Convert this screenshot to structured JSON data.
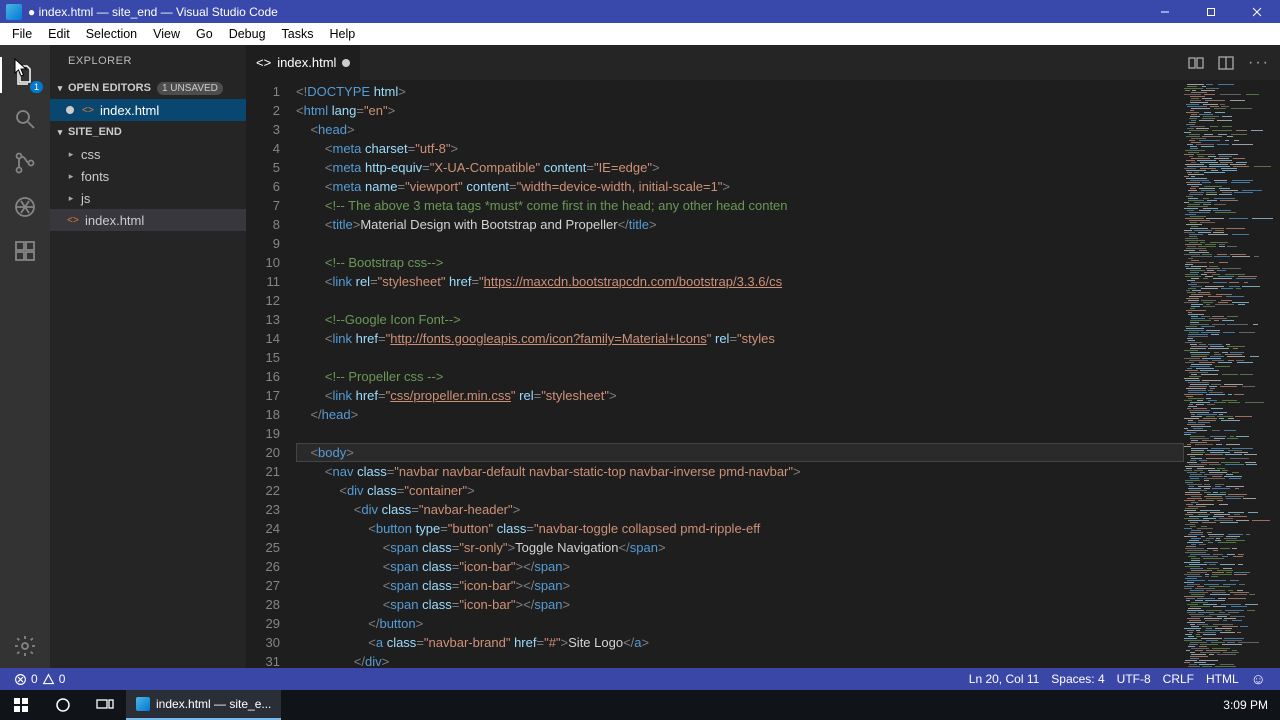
{
  "window": {
    "title": "● index.html — site_end — Visual Studio Code"
  },
  "menus": [
    "File",
    "Edit",
    "Selection",
    "View",
    "Go",
    "Debug",
    "Tasks",
    "Help"
  ],
  "activity": {
    "explorer_badge": "1"
  },
  "explorer": {
    "title": "EXPLORER",
    "open_editors": "OPEN EDITORS",
    "unsaved_tag": "1 UNSAVED",
    "open_file": "index.html",
    "project": "SITE_END",
    "folders": [
      "css",
      "fonts",
      "js"
    ],
    "file": "index.html"
  },
  "tab": {
    "name": "index.html"
  },
  "status": {
    "errors": "0",
    "warnings": "0",
    "ln_col": "Ln 20, Col 11",
    "spaces": "Spaces: 4",
    "encoding": "UTF-8",
    "eol": "CRLF",
    "lang": "HTML"
  },
  "taskbar": {
    "task_label": "index.html — site_e...",
    "clock": "3:09 PM"
  },
  "code": [
    {
      "n": 1,
      "i": 0,
      "tokens": [
        [
          "punc",
          "<!"
        ],
        [
          "doc",
          "DOCTYPE "
        ],
        [
          "attr",
          "html"
        ],
        [
          "punc",
          ">"
        ]
      ]
    },
    {
      "n": 2,
      "i": 0,
      "tokens": [
        [
          "punc",
          "<"
        ],
        [
          "tag",
          "html "
        ],
        [
          "attr",
          "lang"
        ],
        [
          "punc",
          "="
        ],
        [
          "str",
          "\"en\""
        ],
        [
          "punc",
          ">"
        ]
      ]
    },
    {
      "n": 3,
      "i": 1,
      "tokens": [
        [
          "punc",
          "<"
        ],
        [
          "tag",
          "head"
        ],
        [
          "punc",
          ">"
        ]
      ]
    },
    {
      "n": 4,
      "i": 2,
      "tokens": [
        [
          "punc",
          "<"
        ],
        [
          "tag",
          "meta "
        ],
        [
          "attr",
          "charset"
        ],
        [
          "punc",
          "="
        ],
        [
          "str",
          "\"utf-8\""
        ],
        [
          "punc",
          ">"
        ]
      ]
    },
    {
      "n": 5,
      "i": 2,
      "tokens": [
        [
          "punc",
          "<"
        ],
        [
          "tag",
          "meta "
        ],
        [
          "attr",
          "http-equiv"
        ],
        [
          "punc",
          "="
        ],
        [
          "str",
          "\"X-UA-Compatible\" "
        ],
        [
          "attr",
          "content"
        ],
        [
          "punc",
          "="
        ],
        [
          "str",
          "\"IE=edge\""
        ],
        [
          "punc",
          ">"
        ]
      ]
    },
    {
      "n": 6,
      "i": 2,
      "tokens": [
        [
          "punc",
          "<"
        ],
        [
          "tag",
          "meta "
        ],
        [
          "attr",
          "name"
        ],
        [
          "punc",
          "="
        ],
        [
          "str",
          "\"viewport\" "
        ],
        [
          "attr",
          "content"
        ],
        [
          "punc",
          "="
        ],
        [
          "str",
          "\"width=device-width, initial-scale=1\""
        ],
        [
          "punc",
          ">"
        ]
      ]
    },
    {
      "n": 7,
      "i": 2,
      "tokens": [
        [
          "cmt",
          "<!-- The above 3 meta tags *must* come first in the head; any other head conten"
        ]
      ]
    },
    {
      "n": 8,
      "i": 2,
      "tokens": [
        [
          "punc",
          "<"
        ],
        [
          "tag",
          "title"
        ],
        [
          "punc",
          ">"
        ],
        [
          "text",
          "Material Design with Bootstrap and Propeller"
        ],
        [
          "punc",
          "</"
        ],
        [
          "tag",
          "title"
        ],
        [
          "punc",
          ">"
        ]
      ]
    },
    {
      "n": 9,
      "i": 0,
      "tokens": []
    },
    {
      "n": 10,
      "i": 2,
      "tokens": [
        [
          "cmt",
          "<!-- Bootstrap css-->"
        ]
      ]
    },
    {
      "n": 11,
      "i": 2,
      "tokens": [
        [
          "punc",
          "<"
        ],
        [
          "tag",
          "link "
        ],
        [
          "attr",
          "rel"
        ],
        [
          "punc",
          "="
        ],
        [
          "str",
          "\"stylesheet\" "
        ],
        [
          "attr",
          "href"
        ],
        [
          "punc",
          "="
        ],
        [
          "str",
          "\""
        ],
        [
          "link",
          "https://maxcdn.bootstrapcdn.com/bootstrap/3.3.6/cs"
        ]
      ]
    },
    {
      "n": 12,
      "i": 0,
      "tokens": []
    },
    {
      "n": 13,
      "i": 2,
      "tokens": [
        [
          "cmt",
          "<!--Google Icon Font-->"
        ]
      ]
    },
    {
      "n": 14,
      "i": 2,
      "tokens": [
        [
          "punc",
          "<"
        ],
        [
          "tag",
          "link "
        ],
        [
          "attr",
          "href"
        ],
        [
          "punc",
          "="
        ],
        [
          "str",
          "\""
        ],
        [
          "link",
          "http://fonts.googleapis.com/icon?family=Material+Icons"
        ],
        [
          "str",
          "\" "
        ],
        [
          "attr",
          "rel"
        ],
        [
          "punc",
          "="
        ],
        [
          "str",
          "\"styles"
        ]
      ]
    },
    {
      "n": 15,
      "i": 0,
      "tokens": []
    },
    {
      "n": 16,
      "i": 2,
      "tokens": [
        [
          "cmt",
          "<!-- Propeller css -->"
        ]
      ]
    },
    {
      "n": 17,
      "i": 2,
      "tokens": [
        [
          "punc",
          "<"
        ],
        [
          "tag",
          "link "
        ],
        [
          "attr",
          "href"
        ],
        [
          "punc",
          "="
        ],
        [
          "str",
          "\""
        ],
        [
          "link",
          "css/propeller.min.css"
        ],
        [
          "str",
          "\" "
        ],
        [
          "attr",
          "rel"
        ],
        [
          "punc",
          "="
        ],
        [
          "str",
          "\"stylesheet\""
        ],
        [
          "punc",
          ">"
        ]
      ]
    },
    {
      "n": 18,
      "i": 1,
      "tokens": [
        [
          "punc",
          "</"
        ],
        [
          "tag",
          "head"
        ],
        [
          "punc",
          ">"
        ]
      ]
    },
    {
      "n": 19,
      "i": 0,
      "tokens": []
    },
    {
      "n": 20,
      "i": 1,
      "hl": true,
      "tokens": [
        [
          "punc",
          "<"
        ],
        [
          "tag",
          "body"
        ],
        [
          "punc",
          ">"
        ]
      ]
    },
    {
      "n": 21,
      "i": 2,
      "tokens": [
        [
          "punc",
          "<"
        ],
        [
          "tag",
          "nav "
        ],
        [
          "attr",
          "class"
        ],
        [
          "punc",
          "="
        ],
        [
          "str",
          "\"navbar navbar-default navbar-static-top navbar-inverse pmd-navbar\""
        ],
        [
          "punc",
          ">"
        ]
      ]
    },
    {
      "n": 22,
      "i": 3,
      "tokens": [
        [
          "punc",
          "<"
        ],
        [
          "tag",
          "div "
        ],
        [
          "attr",
          "class"
        ],
        [
          "punc",
          "="
        ],
        [
          "str",
          "\"container\""
        ],
        [
          "punc",
          ">"
        ]
      ]
    },
    {
      "n": 23,
      "i": 4,
      "tokens": [
        [
          "punc",
          "<"
        ],
        [
          "tag",
          "div "
        ],
        [
          "attr",
          "class"
        ],
        [
          "punc",
          "="
        ],
        [
          "str",
          "\"navbar-header\""
        ],
        [
          "punc",
          ">"
        ]
      ]
    },
    {
      "n": 24,
      "i": 5,
      "tokens": [
        [
          "punc",
          "<"
        ],
        [
          "tag",
          "button "
        ],
        [
          "attr",
          "type"
        ],
        [
          "punc",
          "="
        ],
        [
          "str",
          "\"button\" "
        ],
        [
          "attr",
          "class"
        ],
        [
          "punc",
          "="
        ],
        [
          "str",
          "\"navbar-toggle collapsed pmd-ripple-eff"
        ]
      ]
    },
    {
      "n": 25,
      "i": 6,
      "tokens": [
        [
          "punc",
          "<"
        ],
        [
          "tag",
          "span "
        ],
        [
          "attr",
          "class"
        ],
        [
          "punc",
          "="
        ],
        [
          "str",
          "\"sr-only\""
        ],
        [
          "punc",
          ">"
        ],
        [
          "text",
          "Toggle Navigation"
        ],
        [
          "punc",
          "</"
        ],
        [
          "tag",
          "span"
        ],
        [
          "punc",
          ">"
        ]
      ]
    },
    {
      "n": 26,
      "i": 6,
      "tokens": [
        [
          "punc",
          "<"
        ],
        [
          "tag",
          "span "
        ],
        [
          "attr",
          "class"
        ],
        [
          "punc",
          "="
        ],
        [
          "str",
          "\"icon-bar\""
        ],
        [
          "punc",
          "></"
        ],
        [
          "tag",
          "span"
        ],
        [
          "punc",
          ">"
        ]
      ]
    },
    {
      "n": 27,
      "i": 6,
      "tokens": [
        [
          "punc",
          "<"
        ],
        [
          "tag",
          "span "
        ],
        [
          "attr",
          "class"
        ],
        [
          "punc",
          "="
        ],
        [
          "str",
          "\"icon-bar\""
        ],
        [
          "punc",
          "></"
        ],
        [
          "tag",
          "span"
        ],
        [
          "punc",
          ">"
        ]
      ]
    },
    {
      "n": 28,
      "i": 6,
      "tokens": [
        [
          "punc",
          "<"
        ],
        [
          "tag",
          "span "
        ],
        [
          "attr",
          "class"
        ],
        [
          "punc",
          "="
        ],
        [
          "str",
          "\"icon-bar\""
        ],
        [
          "punc",
          "></"
        ],
        [
          "tag",
          "span"
        ],
        [
          "punc",
          ">"
        ]
      ]
    },
    {
      "n": 29,
      "i": 5,
      "tokens": [
        [
          "punc",
          "</"
        ],
        [
          "tag",
          "button"
        ],
        [
          "punc",
          ">"
        ]
      ]
    },
    {
      "n": 30,
      "i": 5,
      "tokens": [
        [
          "punc",
          "<"
        ],
        [
          "tag",
          "a "
        ],
        [
          "attr",
          "class"
        ],
        [
          "punc",
          "="
        ],
        [
          "str",
          "\"navbar-brand\" "
        ],
        [
          "attr",
          "href"
        ],
        [
          "punc",
          "="
        ],
        [
          "str",
          "\"#\""
        ],
        [
          "punc",
          ">"
        ],
        [
          "text",
          "Site Logo"
        ],
        [
          "punc",
          "</"
        ],
        [
          "tag",
          "a"
        ],
        [
          "punc",
          ">"
        ]
      ]
    },
    {
      "n": 31,
      "i": 4,
      "tokens": [
        [
          "punc",
          "</"
        ],
        [
          "tag",
          "div"
        ],
        [
          "punc",
          ">"
        ]
      ]
    }
  ]
}
